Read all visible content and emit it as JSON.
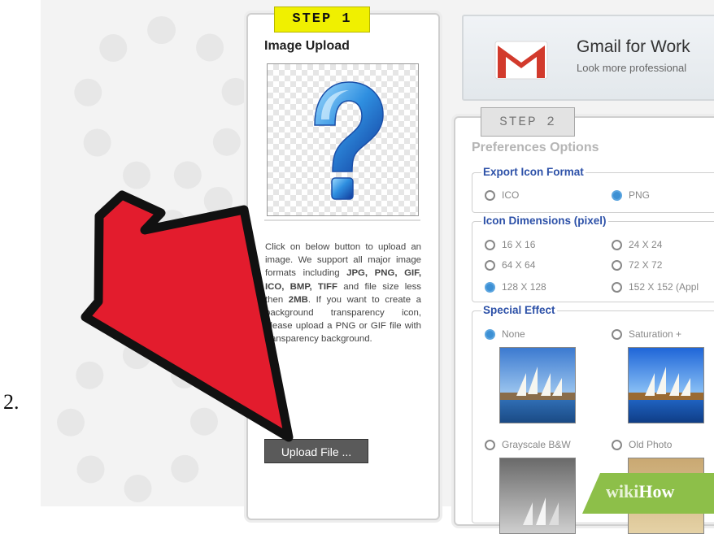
{
  "step_number": "2.",
  "step1": {
    "tab_label": "STEP 1",
    "heading": "Image Upload",
    "description_before": "Click on below button to upload an image. We support all major image formats including ",
    "formats": "JPG, PNG, GIF, ICO, BMP, TIFF",
    "description_mid": " and file size less then ",
    "max_size": "2MB",
    "description_after": ". If you want to create a background transparency icon, please upload a PNG or GIF file with transparency background.",
    "upload_button": "Upload File ..."
  },
  "gmail_ad": {
    "title": "Gmail for Work",
    "subtitle": "Look more professional"
  },
  "step2": {
    "tab_label": "STEP 2",
    "heading": "Preferences Options",
    "export_format": {
      "legend": "Export Icon Format",
      "options": [
        "ICO",
        "PNG"
      ],
      "selected": "PNG"
    },
    "dimensions": {
      "legend": "Icon Dimensions (pixel)",
      "options": [
        "16 X 16",
        "24 X 24",
        "64 X 64",
        "72 X 72",
        "128 X 128",
        "152 X 152 (Appl"
      ],
      "selected": "128 X 128"
    },
    "effects": {
      "legend": "Special Effect",
      "options": [
        "None",
        "Saturation +",
        "Grayscale B&W",
        "Old Photo"
      ],
      "selected": "None"
    }
  },
  "watermark": {
    "prefix": "wiki",
    "suffix": "How"
  },
  "colors": {
    "step1_tab": "#f0f000",
    "legend_blue": "#2d51a8",
    "radio_selected": "#3d90d4",
    "arrow_red": "#e31c2d",
    "wikihow_green": "#8dbf49",
    "gmail_red": "#d23a2c"
  },
  "icons": {
    "preview": "question-mark-icon",
    "gmail": "gmail-logo-icon",
    "pointer": "red-arrow-icon"
  }
}
